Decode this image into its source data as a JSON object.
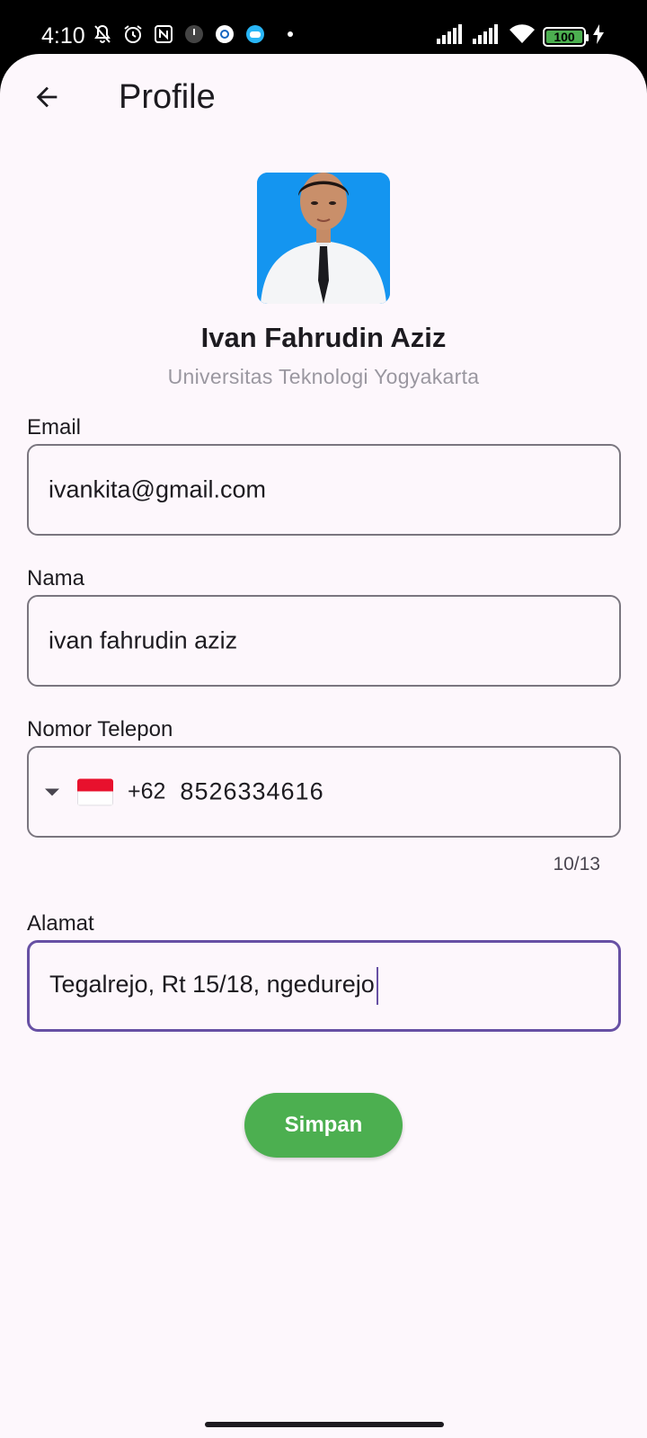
{
  "status_bar": {
    "time": "4:10",
    "battery": "100",
    "icons": [
      "mute-icon",
      "alarm-icon",
      "nfc-icon",
      "app-icon",
      "settings-app-icon",
      "game-icon",
      "signal-icon",
      "signal-icon",
      "wifi-icon",
      "battery-icon",
      "charging-icon"
    ]
  },
  "header": {
    "title": "Profile",
    "back_icon": "arrow-left-icon"
  },
  "profile": {
    "name": "Ivan Fahrudin Aziz",
    "university": "Universitas Teknologi Yogyakarta",
    "photo": "profile-photo"
  },
  "form": {
    "email": {
      "label": "Email",
      "value": "ivankita@gmail.com"
    },
    "nama": {
      "label": "Nama",
      "value": "ivan fahrudin aziz"
    },
    "phone": {
      "label": "Nomor Telepon",
      "dial_code": "+62",
      "value": "8526334616",
      "counter": "10/13",
      "flag": "indonesia-flag"
    },
    "alamat": {
      "label": "Alamat",
      "value": "Tegalrejo, Rt 15/18, ngedurejo"
    }
  },
  "actions": {
    "save_label": "Simpan"
  },
  "colors": {
    "background": "#FDF7FC",
    "primary": "#6750A4",
    "save_button": "#4CAF50",
    "avatar_bg": "#1495F0"
  }
}
